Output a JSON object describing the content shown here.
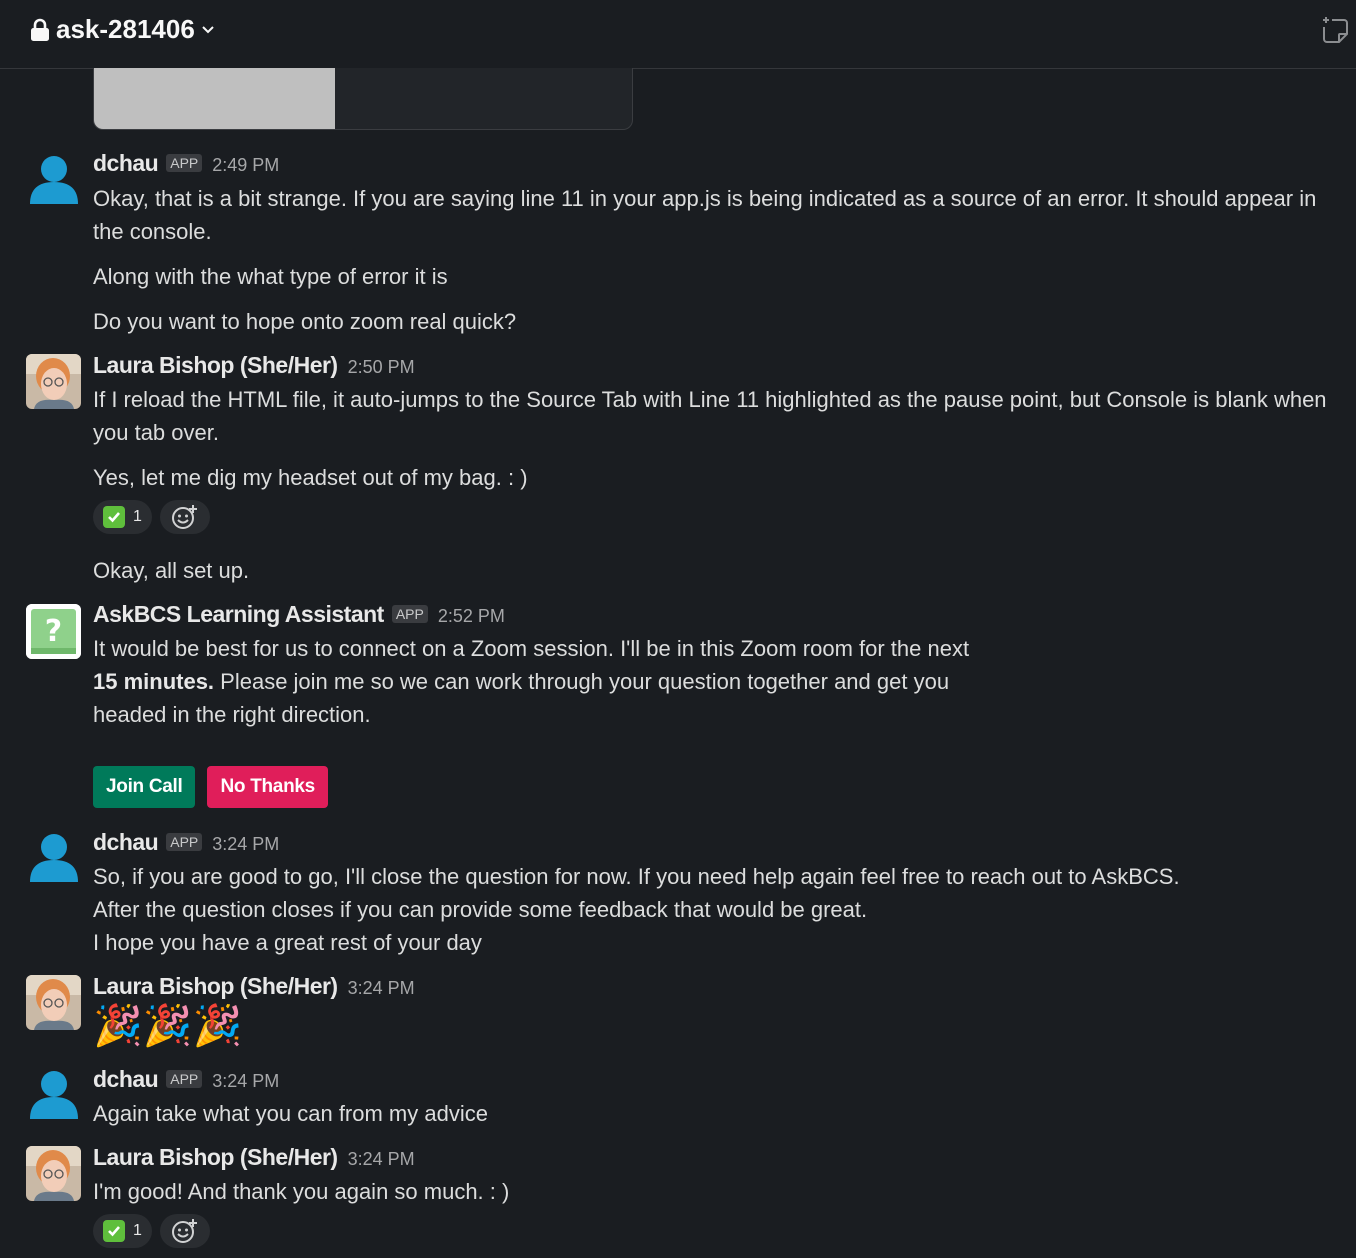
{
  "header": {
    "channel_name": "ask-281406",
    "lock_icon": "lock-icon",
    "chevron_icon": "chevron-down-icon",
    "canvas_icon": "canvas-icon"
  },
  "messages": {
    "m1": {
      "name": "dchau",
      "badge": "APP",
      "time": "2:49 PM",
      "line1": "Okay, that is a bit strange. If you are saying line 11 in your app.js is being indicated as a source of an error. It should appear in",
      "line2": "the console.",
      "line3": "Along with the what type of error it is",
      "line4": "Do you want to hope onto zoom real quick?"
    },
    "m2": {
      "name": "Laura Bishop (She/Her)",
      "time": "2:50 PM",
      "line1": "If I reload the HTML file, it auto-jumps to the Source Tab with Line 11 highlighted as the pause point, but Console is blank when",
      "line2": "you tab over.",
      "line3": "Yes, let me dig my headset out of my bag. : )",
      "reaction_count": "1",
      "line4": "Okay, all set up."
    },
    "m3": {
      "name": "AskBCS Learning Assistant",
      "badge": "APP",
      "time": "2:52 PM",
      "line1": "It would be best for us to connect on a Zoom session. I'll be in this Zoom room for the next",
      "line2_bold": "15 minutes.",
      "line2_rest": " Please join me so we can work through your question together and get you",
      "line3": "headed in the right direction.",
      "join_label": "Join Call",
      "no_label": "No Thanks",
      "accent_join": "#007a5a",
      "accent_no": "#e01e5a"
    },
    "m4": {
      "name": "dchau",
      "badge": "APP",
      "time": "3:24 PM",
      "line1": "So, if you are good to go, I'll close the question for now. If you need help again feel free to reach out to AskBCS.",
      "line2": "After the question closes if you can provide some feedback that would be great.",
      "line3": "I hope you have a great rest of your day"
    },
    "m5": {
      "name": "Laura Bishop (She/Her)",
      "time": "3:24 PM",
      "emoji": "🎉🎉🎉"
    },
    "m6": {
      "name": "dchau",
      "badge": "APP",
      "time": "3:24 PM",
      "line1": "Again take what you can from my advice"
    },
    "m7": {
      "name": "Laura Bishop (She/Her)",
      "time": "3:24 PM",
      "line1": "I'm good! And thank you again so much. : )",
      "reaction_count": "1"
    }
  }
}
